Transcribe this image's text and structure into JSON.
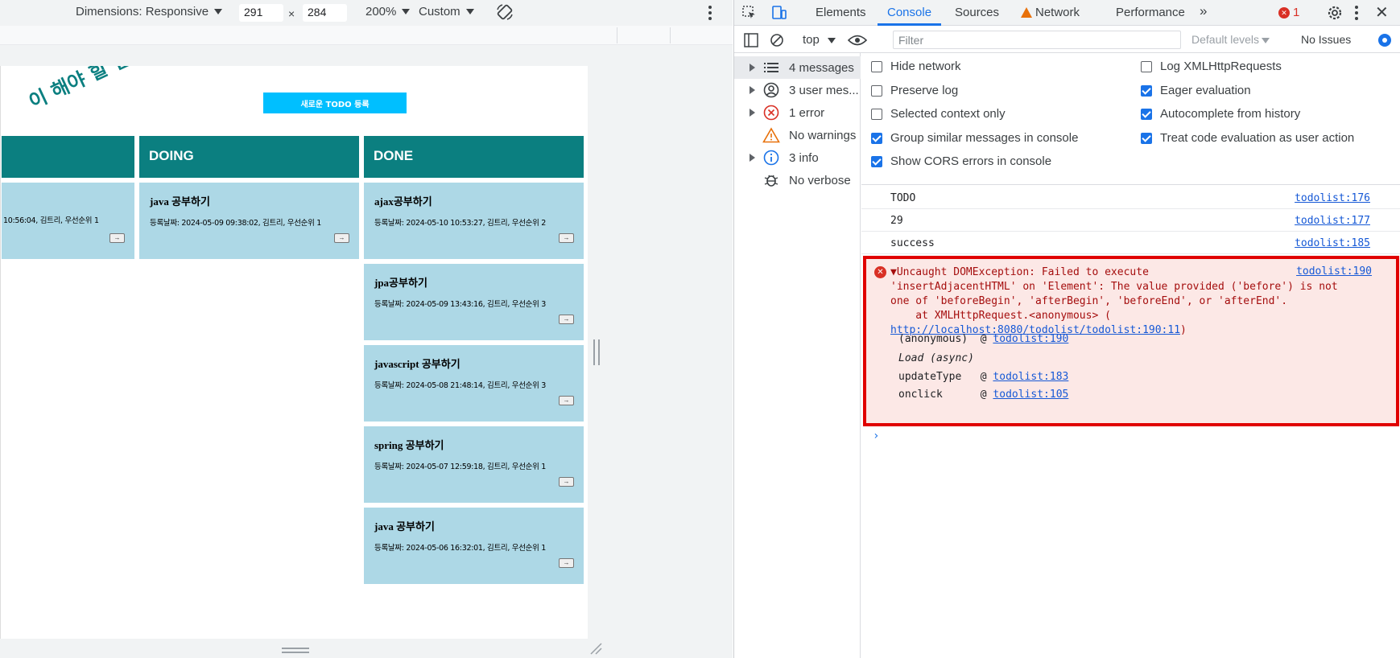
{
  "device_toolbar": {
    "dimensions_label": "Dimensions: Responsive",
    "width": "291",
    "times": "×",
    "height": "284",
    "zoom": "200%",
    "throttle": "Custom"
  },
  "page": {
    "heading": "이 해야 할 일들",
    "new_todo_button": "새로운 TODO 등록",
    "move_button": "→",
    "columns": [
      {
        "header": "",
        "cards": [
          {
            "title": "",
            "meta": "10:56:04, 김트리, 우선순위 1"
          }
        ]
      },
      {
        "header": "DOING",
        "cards": [
          {
            "title": "java 공부하기",
            "meta": "등록날짜: 2024-05-09 09:38:02, 김트리, 우선순위 1"
          }
        ]
      },
      {
        "header": "DONE",
        "cards": [
          {
            "title": "ajax공부하기",
            "meta": "등록날짜: 2024-05-10 10:53:27, 김트리, 우선순위 2"
          },
          {
            "title": "jpa공부하기",
            "meta": "등록날짜: 2024-05-09 13:43:16, 김트리, 우선순위 3"
          },
          {
            "title": "javascript 공부하기",
            "meta": "등록날짜: 2024-05-08 21:48:14, 김트리, 우선순위 3"
          },
          {
            "title": "spring 공부하기",
            "meta": "등록날짜: 2024-05-07 12:59:18, 김트리, 우선순위 1"
          },
          {
            "title": "java 공부하기",
            "meta": "등록날짜: 2024-05-06 16:32:01, 김트리, 우선순위 1"
          }
        ]
      }
    ]
  },
  "devtools": {
    "tabs": [
      "Elements",
      "Console",
      "Sources",
      "Network",
      "Performance"
    ],
    "active_tab": "Console",
    "more_tabs": "»",
    "error_count": "1",
    "context": "top",
    "filter_placeholder": "Filter",
    "levels": "Default levels",
    "issues": "No Issues",
    "sidebar": [
      {
        "label": "4 messages",
        "icon": "list-icon"
      },
      {
        "label": "3 user mes...",
        "icon": "user-icon"
      },
      {
        "label": "1 error",
        "icon": "error-icon"
      },
      {
        "label": "No warnings",
        "icon": "warning-icon"
      },
      {
        "label": "3 info",
        "icon": "info-icon"
      },
      {
        "label": "No verbose",
        "icon": "bug-icon"
      }
    ],
    "settings_left": [
      {
        "label": "Hide network",
        "checked": false
      },
      {
        "label": "Preserve log",
        "checked": false
      },
      {
        "label": "Selected context only",
        "checked": false
      },
      {
        "label": "Group similar messages in console",
        "checked": true
      },
      {
        "label": "Show CORS errors in console",
        "checked": true
      }
    ],
    "settings_right": [
      {
        "label": "Log XMLHttpRequests",
        "checked": false
      },
      {
        "label": "Eager evaluation",
        "checked": true
      },
      {
        "label": "Autocomplete from history",
        "checked": true
      },
      {
        "label": "Treat code evaluation as user action",
        "checked": true
      }
    ],
    "logs": [
      {
        "message": "TODO",
        "source": "todolist:176"
      },
      {
        "message": "29",
        "source": "todolist:177"
      },
      {
        "message": "success",
        "source": "todolist:185"
      }
    ],
    "error": {
      "line1": "▼Uncaught DOMException: Failed to execute",
      "line2": "'insertAdjacentHTML' on 'Element': The value provided ('before') is not",
      "line3": "one of 'beforeBegin', 'afterBegin', 'beforeEnd', or 'afterEnd'.",
      "line4": "    at XMLHttpRequest.<anonymous> (",
      "url": "http://localhost:8080/todolist/todolist:190:11",
      "url_close": ")",
      "source": "todolist:190",
      "stack": [
        {
          "fn": "(anonymous)",
          "at": "@",
          "link": "todolist:190"
        },
        {
          "fn": "Load (async)",
          "at": "",
          "link": ""
        },
        {
          "fn": "updateType",
          "at": "@",
          "link": "todolist:183"
        },
        {
          "fn": "onclick",
          "at": "@",
          "link": "todolist:105"
        }
      ]
    },
    "prompt": "›"
  }
}
